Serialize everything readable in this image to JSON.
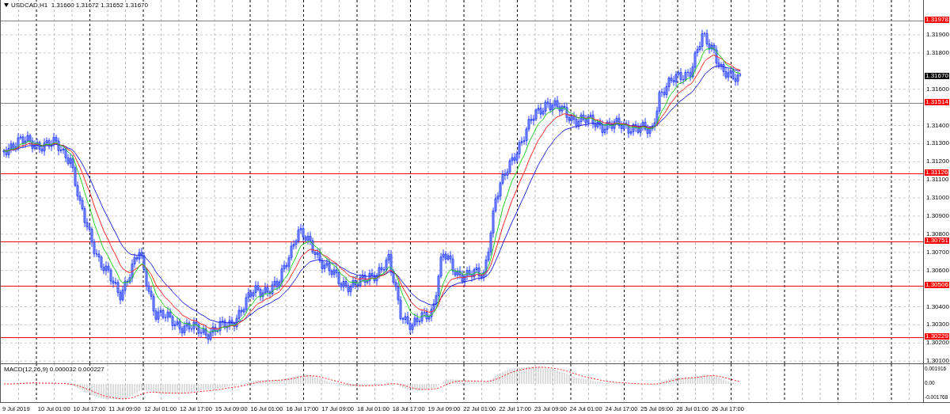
{
  "chart": {
    "title": "USDCAD,H1  1.31660 1.31672 1.31652 1.31670",
    "price_axis": [
      "1.31900",
      "1.31800",
      "1.31600",
      "1.31400",
      "1.31300",
      "1.31200",
      "1.31100",
      "1.31000",
      "1.30900",
      "1.30800",
      "1.30700",
      "1.30600",
      "1.30400",
      "1.30300",
      "1.30200",
      "1.30100"
    ],
    "levels": [
      {
        "label": "1.31978",
        "color": "#808080"
      },
      {
        "label": "1.31514",
        "color": "#808080"
      },
      {
        "label": "1.31126",
        "color": "#ff0000"
      },
      {
        "label": "1.30751",
        "color": "#ff0000"
      },
      {
        "label": "1.30506",
        "color": "#ff0000"
      },
      {
        "label": "1.30229",
        "color": "#ff0000"
      }
    ],
    "current_price": "1.31670"
  },
  "macd": {
    "label": "MACD(12,26,9) 0.000032 0.000227",
    "axis": [
      "0.001916",
      "0.00",
      "-0.001768"
    ]
  },
  "time_axis": [
    "9 Jul 2019",
    "10 Jul 01:00",
    "10 Jul 17:00",
    "11 Jul 09:00",
    "12 Jul 01:00",
    "12 Jul 17:00",
    "15 Jul 09:00",
    "16 Jul 01:00",
    "16 Jul 17:00",
    "17 Jul 09:00",
    "18 Jul 01:00",
    "18 Jul 17:00",
    "19 Jul 09:00",
    "22 Jul 01:00",
    "22 Jul 17:00",
    "23 Jul 09:00",
    "24 Jul 01:00",
    "24 Jul 17:00",
    "25 Jul 09:00",
    "26 Jul 01:00",
    "26 Jul 17:00"
  ]
}
